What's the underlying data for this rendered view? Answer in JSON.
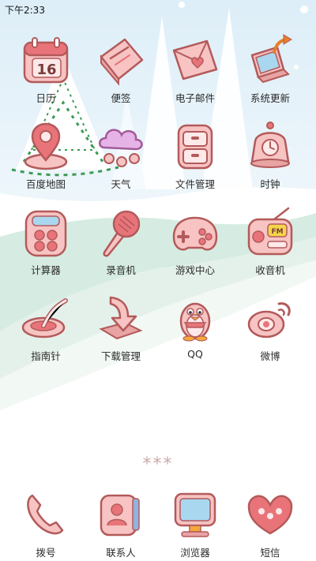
{
  "status_bar": {
    "time": "下午2:33"
  },
  "apps": [
    {
      "label": "日历",
      "icon": "calendar-icon",
      "calendar_date": "16"
    },
    {
      "label": "便签",
      "icon": "notepad-icon"
    },
    {
      "label": "电子邮件",
      "icon": "envelope-icon"
    },
    {
      "label": "系统更新",
      "icon": "laptop-update-icon"
    },
    {
      "label": "百度地图",
      "icon": "map-pin-icon"
    },
    {
      "label": "天气",
      "icon": "cloud-snow-icon"
    },
    {
      "label": "文件管理",
      "icon": "drawer-icon"
    },
    {
      "label": "时钟",
      "icon": "alarm-clock-icon"
    },
    {
      "label": "计算器",
      "icon": "calculator-icon"
    },
    {
      "label": "录音机",
      "icon": "microphone-icon"
    },
    {
      "label": "游戏中心",
      "icon": "gamepad-icon"
    },
    {
      "label": "收音机",
      "icon": "radio-icon",
      "radio_text": "FM"
    },
    {
      "label": "指南针",
      "icon": "compass-spoon-icon"
    },
    {
      "label": "下载管理",
      "icon": "download-arrow-icon"
    },
    {
      "label": "QQ",
      "icon": "penguin-icon"
    },
    {
      "label": "微博",
      "icon": "weibo-eye-icon"
    }
  ],
  "dock": [
    {
      "label": "拨号",
      "icon": "phone-handset-icon"
    },
    {
      "label": "联系人",
      "icon": "contact-card-icon"
    },
    {
      "label": "浏览器",
      "icon": "monitor-icon"
    },
    {
      "label": "短信",
      "icon": "speech-heart-icon"
    }
  ],
  "page_indicator": "***",
  "colors": {
    "icon_fill": "#f7c3c3",
    "icon_stroke": "#b35a5a",
    "accent_red": "#e8747a",
    "snow_blue": "#dceef7",
    "grass_green": "#cfe9da"
  }
}
